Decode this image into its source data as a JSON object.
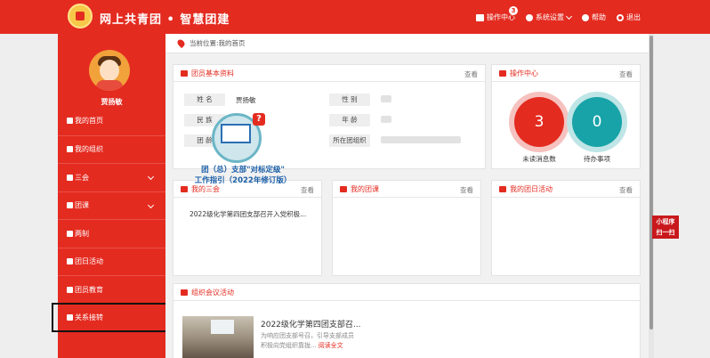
{
  "header": {
    "brand": "网上共青团 • 智慧团建",
    "actions": [
      {
        "label": "操作中心",
        "icon": "mail-icon",
        "badge": "3"
      },
      {
        "label": "系统设置",
        "icon": "user-icon"
      },
      {
        "label": "帮助",
        "icon": "help-icon"
      },
      {
        "label": "退出",
        "icon": "logout-icon"
      }
    ]
  },
  "sidebar": {
    "username": "贾扬敏",
    "items": [
      {
        "label": "我的首页",
        "icon": "home-icon"
      },
      {
        "label": "我的组织",
        "icon": "group-icon"
      },
      {
        "label": "三会",
        "icon": "checkbox-icon",
        "expandable": true
      },
      {
        "label": "团课",
        "icon": "folder-icon",
        "expandable": true
      },
      {
        "label": "两制",
        "icon": "target-icon"
      },
      {
        "label": "团日活动",
        "icon": "recycle-icon"
      },
      {
        "label": "团员教育",
        "icon": "graduation-icon"
      },
      {
        "label": "关系接转",
        "icon": "transfer-icon"
      }
    ]
  },
  "breadcrumb": "当前位置:我的首页",
  "member_info": {
    "title": "团员基本资料",
    "more": "查看",
    "labels": {
      "name": "姓 名",
      "gender": "性 别",
      "ethnicity": "民 族",
      "age": "年 龄",
      "league_age": "团 龄",
      "org": "所在团组织"
    },
    "values": {
      "name": "贾扬敏"
    }
  },
  "operation_center": {
    "title": "操作中心",
    "more": "查看",
    "unread_count": "3",
    "unread_label": "未读消息数",
    "todo_count": "0",
    "todo_label": "待办事项"
  },
  "promo": {
    "line1": "团（总）支部\"对标定级\"",
    "line2": "工作指引（2022年修订版）"
  },
  "my_three_meetings": {
    "title": "我的三会",
    "more": "查看",
    "items": [
      "2022级化学第四团支部召开入党积极..."
    ]
  },
  "my_league_class": {
    "title": "我的团课",
    "more": "查看"
  },
  "my_league_day": {
    "title": "我的团日活动",
    "more": "查看"
  },
  "org_meeting": {
    "title": "组织会议活动",
    "item_title": "2022级化学第四团支部召...",
    "desc1": "为响应团支部号召，引导支部成员",
    "desc2": "积极向党组织靠拢...",
    "read_more": "阅读全文"
  },
  "mini_program": {
    "line1": "小程序",
    "line2": "扫一扫"
  }
}
